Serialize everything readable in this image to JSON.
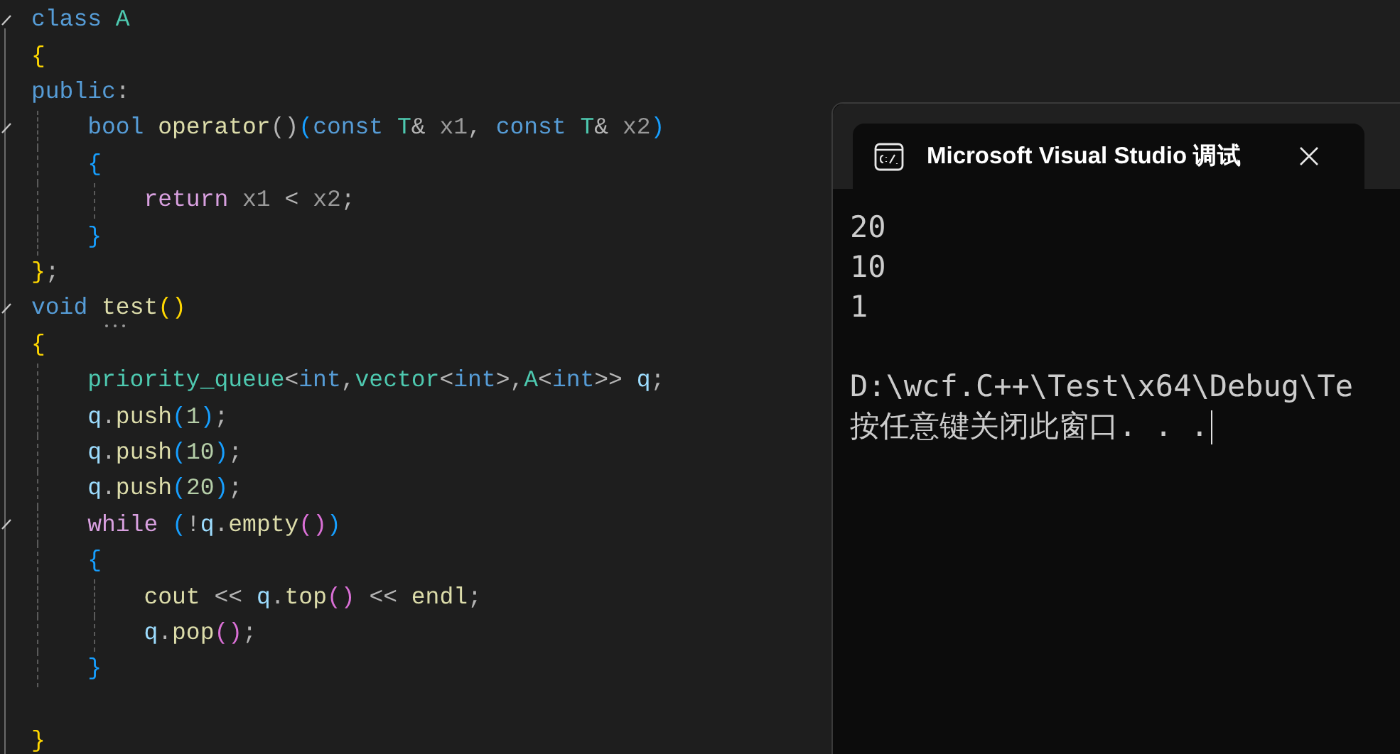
{
  "editor": {
    "lines": [
      {
        "fold": true,
        "tokens": [
          {
            "kind": "keyword",
            "text": "class "
          },
          {
            "kind": "type",
            "text": "A"
          }
        ]
      },
      {
        "fold": false,
        "tokens": [
          {
            "kind": "brace1",
            "text": "{"
          }
        ]
      },
      {
        "fold": false,
        "tokens": [
          {
            "kind": "keyword",
            "text": "public"
          },
          {
            "kind": "plain",
            "text": ":"
          }
        ]
      },
      {
        "fold": true,
        "tokens": [
          {
            "kind": "keyword",
            "text": "    bool "
          },
          {
            "kind": "func",
            "text": "operator"
          },
          {
            "kind": "plain",
            "text": "()"
          },
          {
            "kind": "brace2",
            "text": "("
          },
          {
            "kind": "keyword",
            "text": "const "
          },
          {
            "kind": "type",
            "text": "T"
          },
          {
            "kind": "plain",
            "text": "& "
          },
          {
            "kind": "param",
            "text": "x1"
          },
          {
            "kind": "plain",
            "text": ", "
          },
          {
            "kind": "keyword",
            "text": "const "
          },
          {
            "kind": "type",
            "text": "T"
          },
          {
            "kind": "plain",
            "text": "& "
          },
          {
            "kind": "param",
            "text": "x2"
          },
          {
            "kind": "brace2",
            "text": ")"
          }
        ]
      },
      {
        "fold": false,
        "tokens": [
          {
            "kind": "brace3",
            "text": "    {"
          }
        ]
      },
      {
        "fold": false,
        "tokens": [
          {
            "kind": "control",
            "text": "        return "
          },
          {
            "kind": "param",
            "text": "x1"
          },
          {
            "kind": "plain",
            "text": " < "
          },
          {
            "kind": "param",
            "text": "x2"
          },
          {
            "kind": "plain",
            "text": ";"
          }
        ]
      },
      {
        "fold": false,
        "tokens": [
          {
            "kind": "brace3",
            "text": "    }"
          }
        ]
      },
      {
        "fold": false,
        "tokens": [
          {
            "kind": "brace1",
            "text": "}"
          },
          {
            "kind": "plain",
            "text": ";"
          }
        ]
      },
      {
        "fold": true,
        "tokens": [
          {
            "kind": "keyword",
            "text": "void "
          },
          {
            "kind": "func",
            "text": "test",
            "hint": true
          },
          {
            "kind": "brace1",
            "text": "()"
          }
        ]
      },
      {
        "fold": false,
        "tokens": [
          {
            "kind": "brace1",
            "text": "{"
          }
        ]
      },
      {
        "fold": false,
        "tokens": [
          {
            "kind": "type",
            "text": "    priority_queue"
          },
          {
            "kind": "plain",
            "text": "<"
          },
          {
            "kind": "keyword",
            "text": "int"
          },
          {
            "kind": "plain",
            "text": ","
          },
          {
            "kind": "type",
            "text": "vector"
          },
          {
            "kind": "plain",
            "text": "<"
          },
          {
            "kind": "keyword",
            "text": "int"
          },
          {
            "kind": "plain",
            "text": ">,"
          },
          {
            "kind": "type",
            "text": "A"
          },
          {
            "kind": "plain",
            "text": "<"
          },
          {
            "kind": "keyword",
            "text": "int"
          },
          {
            "kind": "plain",
            "text": ">> "
          },
          {
            "kind": "local",
            "text": "q"
          },
          {
            "kind": "plain",
            "text": ";"
          }
        ]
      },
      {
        "fold": false,
        "tokens": [
          {
            "kind": "local",
            "text": "    q"
          },
          {
            "kind": "plain",
            "text": "."
          },
          {
            "kind": "func",
            "text": "push"
          },
          {
            "kind": "brace2",
            "text": "("
          },
          {
            "kind": "number",
            "text": "1"
          },
          {
            "kind": "brace2",
            "text": ")"
          },
          {
            "kind": "plain",
            "text": ";"
          }
        ]
      },
      {
        "fold": false,
        "tokens": [
          {
            "kind": "local",
            "text": "    q"
          },
          {
            "kind": "plain",
            "text": "."
          },
          {
            "kind": "func",
            "text": "push"
          },
          {
            "kind": "brace2",
            "text": "("
          },
          {
            "kind": "number",
            "text": "10"
          },
          {
            "kind": "brace2",
            "text": ")"
          },
          {
            "kind": "plain",
            "text": ";"
          }
        ]
      },
      {
        "fold": false,
        "tokens": [
          {
            "kind": "local",
            "text": "    q"
          },
          {
            "kind": "plain",
            "text": "."
          },
          {
            "kind": "func",
            "text": "push"
          },
          {
            "kind": "brace2",
            "text": "("
          },
          {
            "kind": "number",
            "text": "20"
          },
          {
            "kind": "brace2",
            "text": ")"
          },
          {
            "kind": "plain",
            "text": ";"
          }
        ]
      },
      {
        "fold": true,
        "tokens": [
          {
            "kind": "control",
            "text": "    while "
          },
          {
            "kind": "brace2",
            "text": "("
          },
          {
            "kind": "plain",
            "text": "!"
          },
          {
            "kind": "local",
            "text": "q"
          },
          {
            "kind": "plain",
            "text": "."
          },
          {
            "kind": "func",
            "text": "empty"
          },
          {
            "kind": "brace4",
            "text": "()"
          },
          {
            "kind": "brace2",
            "text": ")"
          }
        ]
      },
      {
        "fold": false,
        "tokens": [
          {
            "kind": "brace2",
            "text": "    {"
          }
        ]
      },
      {
        "fold": false,
        "tokens": [
          {
            "kind": "var",
            "text": "        cout "
          },
          {
            "kind": "plain",
            "text": "<< "
          },
          {
            "kind": "local",
            "text": "q"
          },
          {
            "kind": "plain",
            "text": "."
          },
          {
            "kind": "func",
            "text": "top"
          },
          {
            "kind": "brace4",
            "text": "()"
          },
          {
            "kind": "plain",
            "text": " << "
          },
          {
            "kind": "func",
            "text": "endl"
          },
          {
            "kind": "plain",
            "text": ";"
          }
        ]
      },
      {
        "fold": false,
        "tokens": [
          {
            "kind": "local",
            "text": "        q"
          },
          {
            "kind": "plain",
            "text": "."
          },
          {
            "kind": "func",
            "text": "pop"
          },
          {
            "kind": "brace4",
            "text": "()"
          },
          {
            "kind": "plain",
            "text": ";"
          }
        ]
      },
      {
        "fold": false,
        "tokens": [
          {
            "kind": "brace2",
            "text": "    }"
          }
        ]
      },
      {
        "fold": false
      },
      {
        "fold": false,
        "tokens": [
          {
            "kind": "brace1",
            "text": "}"
          }
        ]
      }
    ]
  },
  "console": {
    "title": "Microsoft Visual Studio 调试",
    "output": [
      "20",
      "10",
      "1"
    ],
    "path": "D:\\wcf.C++\\Test\\x64\\Debug\\Te",
    "prompt": "按任意键关闭此窗口. . ."
  }
}
